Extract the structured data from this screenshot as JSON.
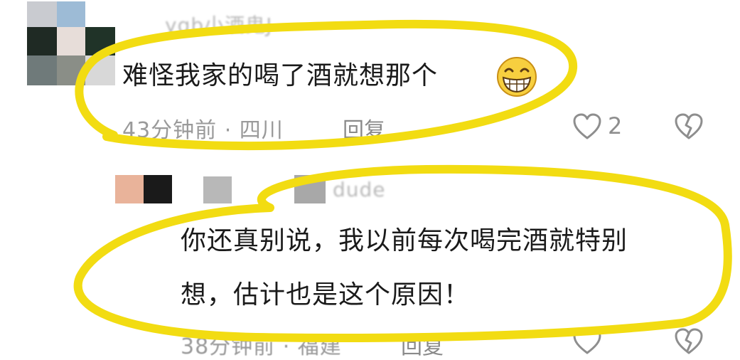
{
  "comments": [
    {
      "username": "ygb小酒鬼J",
      "text": "难怪我家的喝了酒就想那个",
      "emoji": "😁",
      "time_location": "43分钟前 · 四川",
      "reply_label": "回复",
      "like_count": "2"
    },
    {
      "username": "dude",
      "text_line1": "你还真别说，我以前每次喝完酒就特别",
      "text_line2": "想，估计也是这个原因！",
      "time_location": "38分钟前 · 福建",
      "reply_label": "回复"
    }
  ],
  "colors": {
    "highlight": "#f2dc12",
    "text": "#1a1a1a",
    "meta": "#9a9a9a"
  },
  "icons": [
    "heart-outline-icon",
    "broken-heart-icon",
    "grinning-emoji-icon"
  ]
}
